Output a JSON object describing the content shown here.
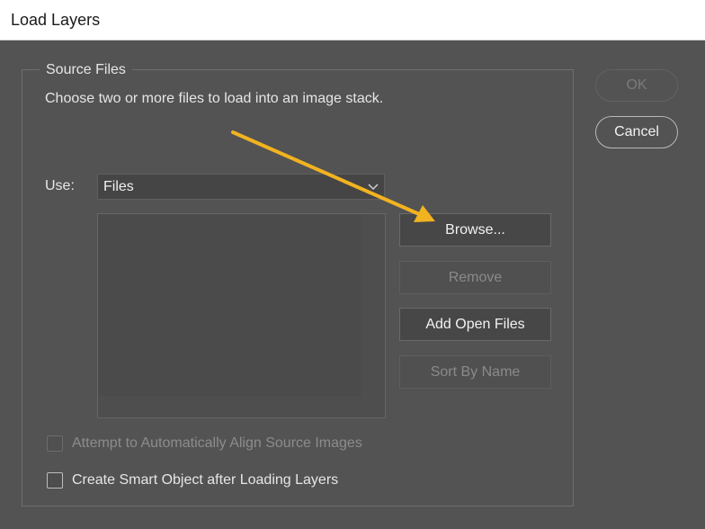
{
  "window": {
    "title": "Load Layers"
  },
  "source_files": {
    "group_label": "Source Files",
    "description": "Choose two or more files to load into an image stack.",
    "use_label": "Use:",
    "use_selected": "Files",
    "buttons": {
      "browse": "Browse...",
      "remove": "Remove",
      "add_open_files": "Add Open Files",
      "sort_by_name": "Sort By Name"
    }
  },
  "options": {
    "auto_align": {
      "label": "Attempt to Automatically Align Source Images",
      "checked": false,
      "enabled": false
    },
    "smart_object": {
      "label": "Create Smart Object after Loading Layers",
      "checked": false,
      "enabled": true
    }
  },
  "actions": {
    "ok": "OK",
    "cancel": "Cancel"
  },
  "colors": {
    "dialog_background": "#535353",
    "annotation_arrow": "#f2b320"
  },
  "annotation": {
    "icon": "arrow-icon"
  }
}
